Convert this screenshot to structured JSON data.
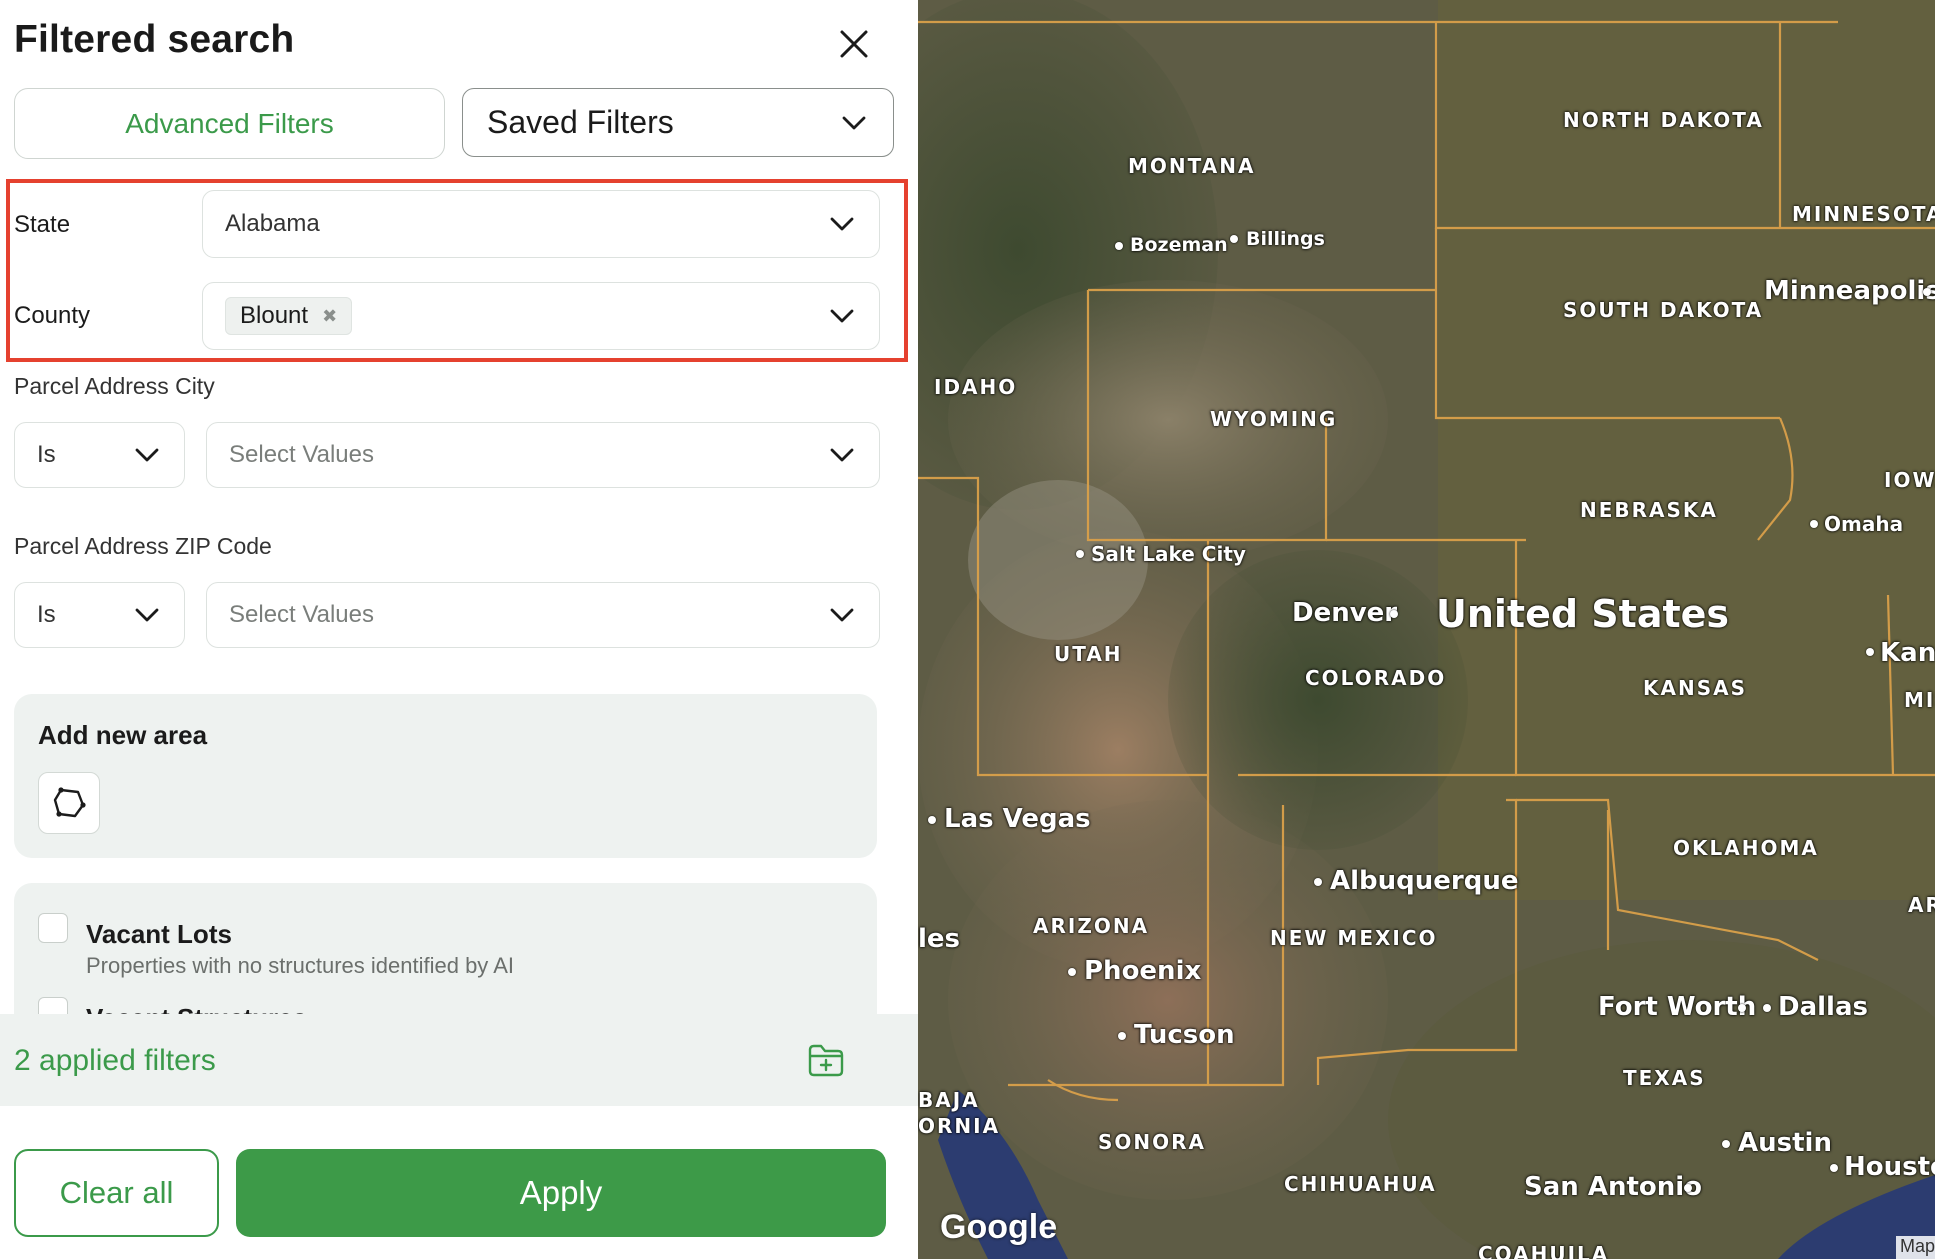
{
  "panel": {
    "title": "Filtered search",
    "tabs": {
      "advanced": "Advanced Filters",
      "saved": "Saved Filters"
    },
    "state": {
      "label": "State",
      "value": "Alabama"
    },
    "county": {
      "label": "County",
      "chip": "Blount"
    },
    "city": {
      "label": "Parcel Address City",
      "operator": "Is",
      "placeholder": "Select Values"
    },
    "zip": {
      "label": "Parcel Address ZIP Code",
      "operator": "Is",
      "placeholder": "Select Values"
    },
    "area": {
      "title": "Add new area"
    },
    "vacant": {
      "title": "Vacant Lots",
      "description": "Properties with no structures identified by AI",
      "next_title": "Vacant Structures"
    },
    "footer": {
      "applied": "2 applied filters"
    },
    "buttons": {
      "clear": "Clear all",
      "apply": "Apply"
    },
    "colors": {
      "accent": "#3b9a4a",
      "highlight": "#e5412f"
    }
  },
  "map": {
    "country": "United States",
    "states": [
      "MONTANA",
      "NORTH DAKOTA",
      "MINNESOTA",
      "SOUTH DAKOTA",
      "IDAHO",
      "WYOMING",
      "NEBRASKA",
      "IOWA",
      "UTAH",
      "COLORADO",
      "KANSAS",
      "ARIZONA",
      "NEW MEXICO",
      "OKLAHOMA",
      "TEXAS",
      "SONORA",
      "CHIHUAHUA",
      "COAHUILA",
      "MIS",
      "AR",
      "BAJA",
      "ORNIA"
    ],
    "cities": [
      "Bozeman",
      "Billings",
      "Minneapolis",
      "Salt Lake City",
      "Omaha",
      "Denver",
      "Kans",
      "Las Vegas",
      "Albuquerque",
      "Phoenix",
      "les",
      "Tucson",
      "Fort Worth",
      "Dallas",
      "Austin",
      "Housto",
      "San Antonio"
    ],
    "attribution": "Google",
    "mapdata": "Map"
  }
}
